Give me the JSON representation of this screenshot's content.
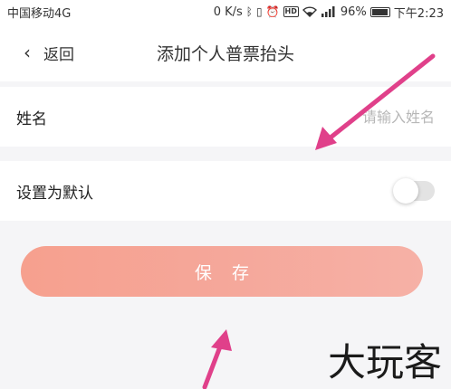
{
  "status_bar": {
    "carrier": "中国移动4G",
    "speed": "0 K/s",
    "battery": "96%",
    "battery_level": 0.96,
    "time": "下午2:23",
    "network": "4G",
    "hd_badge": "HD"
  },
  "nav": {
    "back_label": "返回",
    "title": "添加个人普票抬头"
  },
  "form": {
    "name_label": "姓名",
    "name_value": "",
    "name_placeholder": "请输入姓名",
    "default_label": "设置为默认",
    "default_on": false
  },
  "save_label": "保存",
  "watermark": "大玩客",
  "colors": {
    "save_button": "#f6a79a",
    "arrow": "#e0408a",
    "background": "#f5f5f7"
  }
}
